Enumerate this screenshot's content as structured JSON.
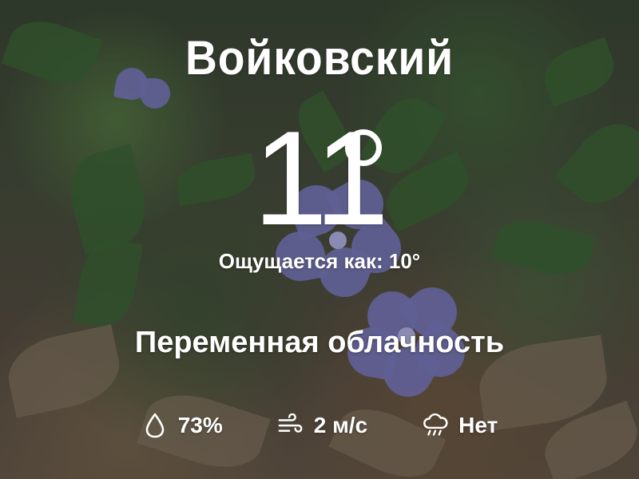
{
  "location": {
    "name": "Войковский"
  },
  "temperature": {
    "value": "11",
    "feels_like": "Ощущается как: 10°"
  },
  "condition": {
    "text": "Переменная облачность"
  },
  "stats": {
    "humidity": {
      "value": "73%",
      "icon": "droplet-icon"
    },
    "wind": {
      "value": "2 м/с",
      "icon": "wind-icon"
    },
    "precipitation": {
      "value": "Нет",
      "icon": "rain-cloud-icon"
    }
  },
  "colors": {
    "text": "#ffffff",
    "flower": "#7f7fc4",
    "foliage": "#3f6a3a"
  }
}
